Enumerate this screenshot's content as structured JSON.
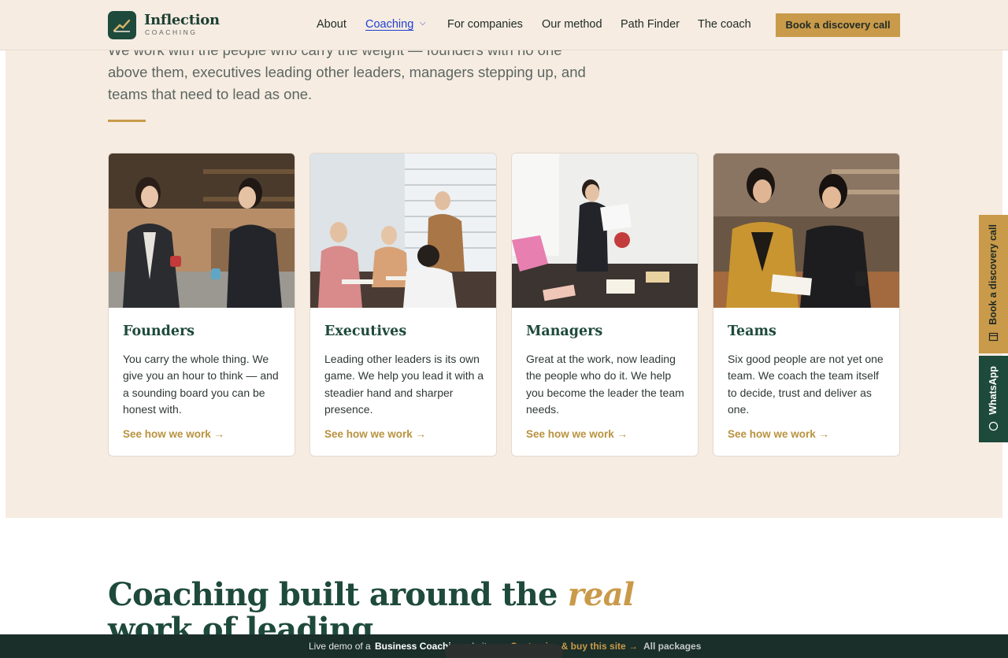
{
  "header": {
    "logo_name": "Inflection",
    "logo_sub": "COACHING",
    "nav": [
      "About",
      "Coaching",
      "For companies",
      "Our method",
      "Path Finder",
      "The coach"
    ],
    "nav_active": "Coaching",
    "cta": "Book a discovery call"
  },
  "intro": {
    "text": "We work with the people who carry the weight — founders with no one above them, executives leading other leaders, managers stepping up, and teams that need to lead as one."
  },
  "cards": [
    {
      "title": "Founders",
      "desc": "You carry the whole thing. We give you an hour to think — and a sounding board you can be honest with.",
      "link": "See how we work →"
    },
    {
      "title": "Executives",
      "desc": "Leading other leaders is its own game. We help you lead it with a steadier hand and sharper presence.",
      "link": "See how we work →"
    },
    {
      "title": "Managers",
      "desc": "Great at the work, now leading the people who do it. We help you become the leader the team needs.",
      "link": "See how we work →"
    },
    {
      "title": "Teams",
      "desc": "Six good people are not yet one team. We coach the team itself to decide, trust and deliver as one.",
      "link": "See how we work →"
    }
  ],
  "side": {
    "book": "Book a discovery call",
    "whatsapp": "WhatsApp"
  },
  "headline": {
    "part1": "Coaching built around the ",
    "accent": "real",
    "part2": " work of leading"
  },
  "demo_bar": {
    "prefix": "Live demo of a ",
    "product": "Business Coaching",
    "suffix": " website",
    "buy": "Customise & buy this site →",
    "packages": "All packages"
  },
  "colors": {
    "brand_green": "#1e4a3c",
    "accent_gold": "#c99a4a",
    "beige": "#f6ece2"
  }
}
